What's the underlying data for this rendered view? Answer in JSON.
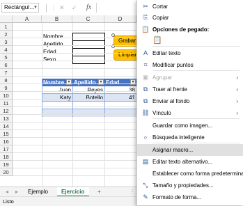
{
  "formula_bar": {
    "name_box": "Rectángul…",
    "cancel_glyph": "✕",
    "enter_glyph": "✓",
    "fx_label": "fx"
  },
  "columns": [
    "A",
    "B",
    "C",
    "D"
  ],
  "rows": [
    "1",
    "2",
    "3",
    "4",
    "5",
    "6",
    "7",
    "8",
    "9",
    "10",
    "11",
    "12",
    "13",
    "14",
    "15",
    "16",
    "17",
    "18",
    "19",
    "20"
  ],
  "form_labels": [
    "Nombre",
    "Apellido",
    "Edad",
    "Sexo"
  ],
  "buttons": {
    "grabar": "Grabar",
    "limpiar": "Limpiar"
  },
  "table": {
    "headers": [
      "Nombre",
      "Apellido",
      "Edad"
    ],
    "filter_glyph": "▾",
    "rows": [
      [
        "Juan",
        "Reyes",
        "38"
      ],
      [
        "Katy",
        "Botello",
        "41"
      ]
    ]
  },
  "sheet_tabs": {
    "nav_prev": "◂",
    "nav_next": "▸",
    "tabs": [
      "Ejemplo",
      "Ejercicio"
    ],
    "active": "Ejercicio",
    "add": "+",
    "more": "⋮"
  },
  "status": {
    "text": "Listo"
  },
  "context_menu": {
    "items": [
      {
        "label": "Cortar",
        "icon": "scissors-icon",
        "glyph": "✂"
      },
      {
        "label": "Copiar",
        "icon": "copy-icon",
        "glyph": "⎘"
      },
      {
        "label": "Opciones de pegado:",
        "icon": "paste-icon",
        "glyph": "📋"
      },
      {
        "label": "",
        "icon": "paste-option-icon",
        "glyph": "📋"
      },
      {
        "label": "Editar texto",
        "icon": "edit-text-icon",
        "glyph": "A"
      },
      {
        "label": "Modificar puntos",
        "icon": "edit-points-icon",
        "glyph": "⌗"
      },
      {
        "label": "Agrupar",
        "icon": "group-icon",
        "glyph": "▣",
        "disabled": true,
        "submenu": true
      },
      {
        "label": "Traer al frente",
        "icon": "bring-front-icon",
        "glyph": "⧉",
        "submenu": true
      },
      {
        "label": "Enviar al fondo",
        "icon": "send-back-icon",
        "glyph": "⧉",
        "submenu": true
      },
      {
        "label": "Vínculo",
        "icon": "link-icon",
        "glyph": "⛓",
        "submenu": true
      },
      {
        "label": "Guardar como imagen...",
        "icon": "",
        "glyph": ""
      },
      {
        "label": "Búsqueda inteligente",
        "icon": "search-icon",
        "glyph": "⌕"
      },
      {
        "label": "Asignar macro...",
        "icon": "",
        "glyph": ""
      },
      {
        "label": "Editar texto alternativo...",
        "icon": "alt-text-icon",
        "glyph": "▤"
      },
      {
        "label": "Establecer como forma predeterminada",
        "icon": "",
        "glyph": ""
      },
      {
        "label": "Tamaño y propiedades...",
        "icon": "size-properties-icon",
        "glyph": "⤡"
      },
      {
        "label": "Formato de forma...",
        "icon": "format-shape-icon",
        "glyph": "✎"
      }
    ],
    "highlighted": "Asignar macro..."
  },
  "colors": {
    "accent_green": "#217346",
    "table_header": "#4472c4",
    "button_fill": "#ffc000",
    "menu_icon": "#2b579a"
  }
}
